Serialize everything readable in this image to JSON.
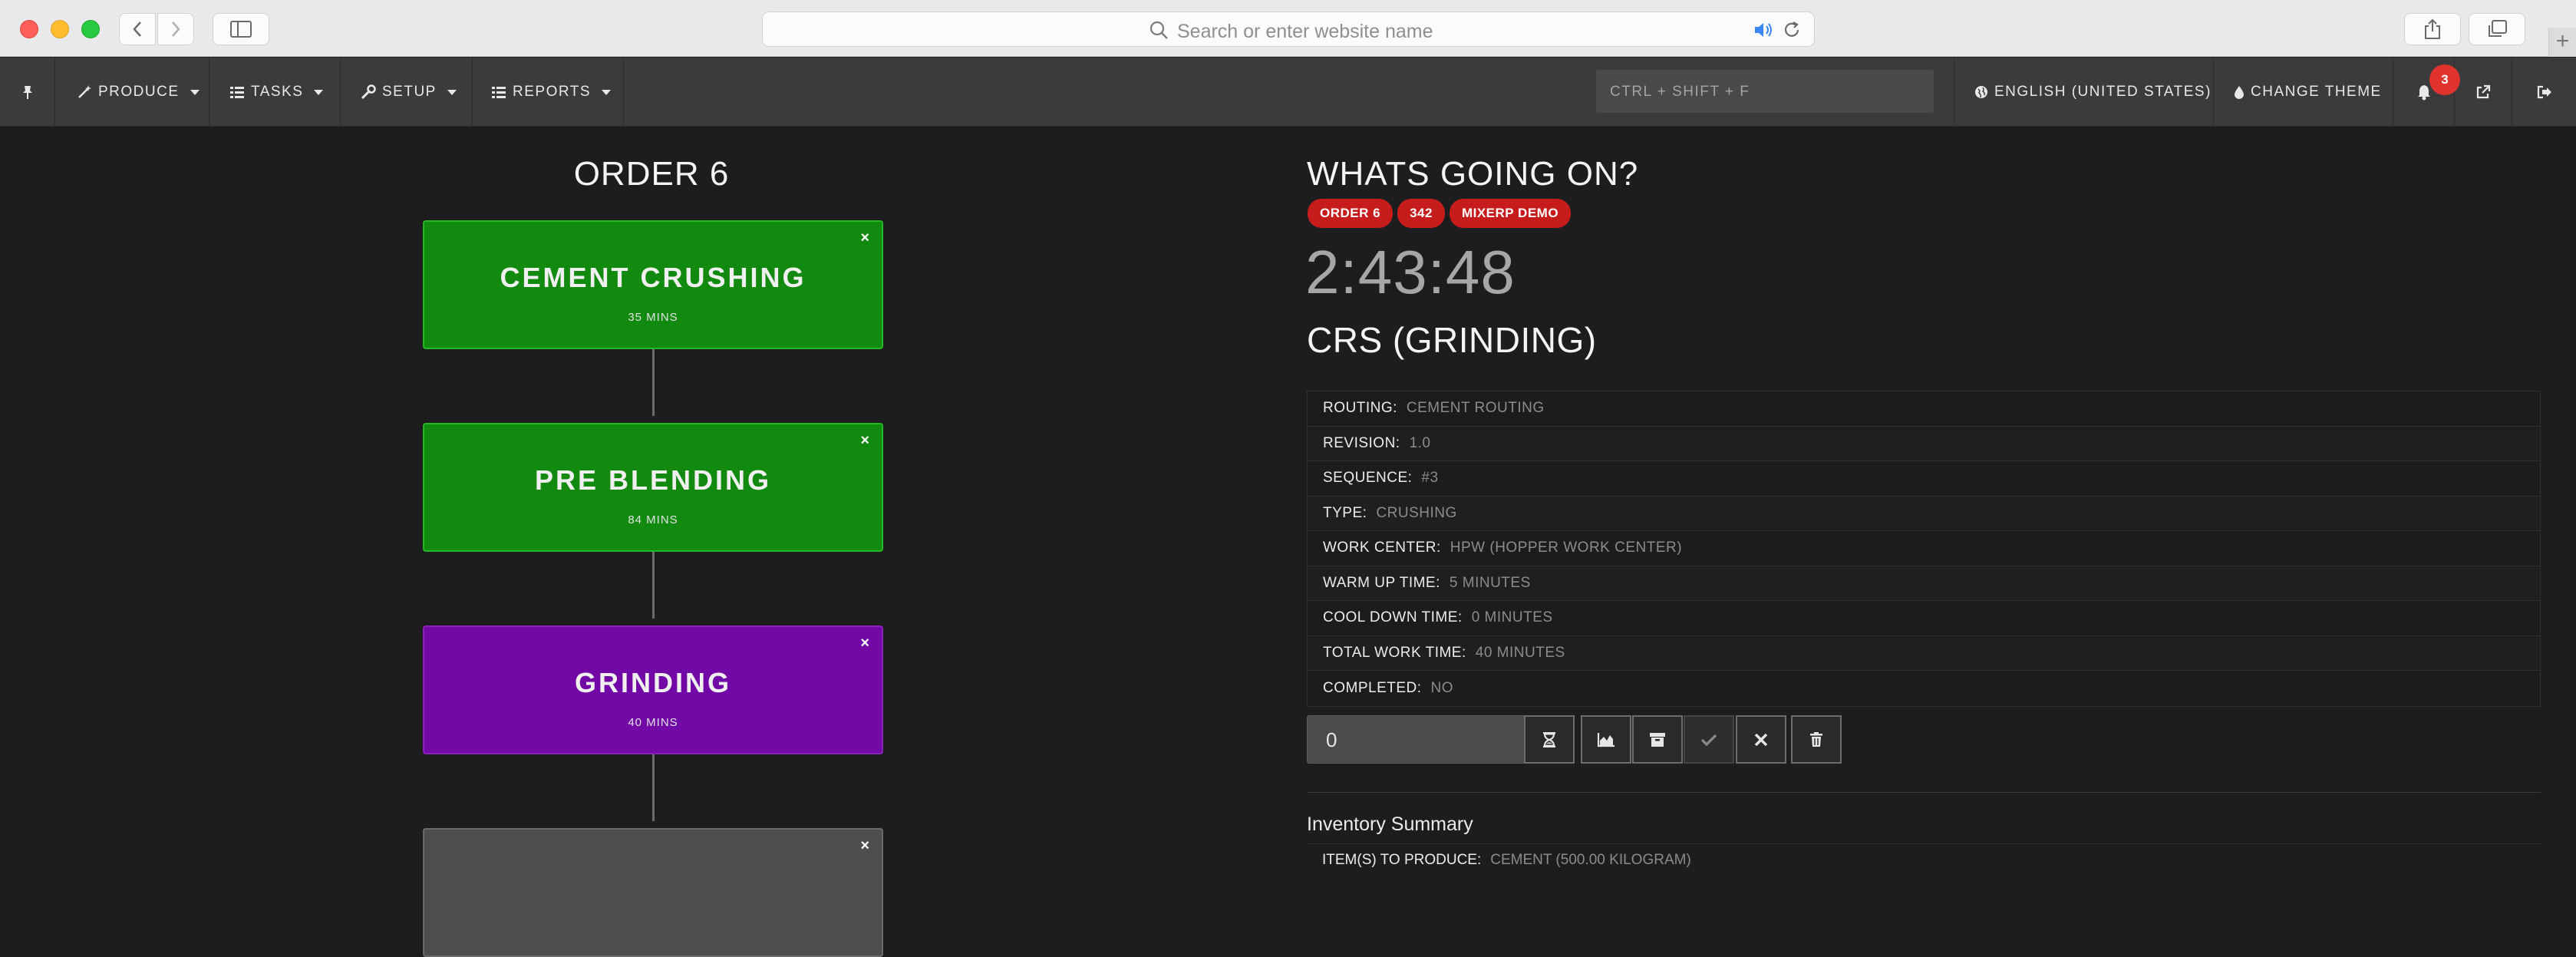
{
  "browser": {
    "address_placeholder": "Search or enter website name"
  },
  "nav": {
    "menus": [
      {
        "label": "PRODUCE",
        "icon": "magic-wand-icon"
      },
      {
        "label": "TASKS",
        "icon": "tasks-icon"
      },
      {
        "label": "SETUP",
        "icon": "wrench-icon"
      },
      {
        "label": "REPORTS",
        "icon": "list-icon"
      }
    ],
    "search_placeholder": "CTRL + SHIFT + F",
    "language": "ENGLISH (UNITED STATES)",
    "theme_label": "CHANGE THEME",
    "notification_count": "3"
  },
  "left": {
    "order_title": "ORDER 6",
    "cards": [
      {
        "title": "CEMENT CRUSHING",
        "duration": "35 MINS",
        "color": "#128a10",
        "close": "×"
      },
      {
        "title": "PRE BLENDING",
        "duration": "84 MINS",
        "color": "#128a10",
        "close": "×"
      },
      {
        "title": "GRINDING",
        "duration": "40 MINS",
        "color": "#7209a6",
        "close": "×"
      },
      {
        "title": "",
        "duration": "",
        "color": "#4e4e50",
        "close": "×"
      }
    ]
  },
  "right": {
    "heading": "WHATS GOING ON?",
    "tags": [
      "ORDER 6",
      "342",
      "MIXERP DEMO"
    ],
    "timer": "2:43:48",
    "operation": "CRS (GRINDING)",
    "details": [
      {
        "key": "ROUTING:",
        "value": "CEMENT ROUTING"
      },
      {
        "key": "REVISION:",
        "value": "1.0"
      },
      {
        "key": "SEQUENCE:",
        "value": "#3"
      },
      {
        "key": "TYPE:",
        "value": "CRUSHING"
      },
      {
        "key": "WORK CENTER:",
        "value": "HPW (HOPPER WORK CENTER)"
      },
      {
        "key": "WARM UP TIME:",
        "value": "5 MINUTES"
      },
      {
        "key": "COOL DOWN TIME:",
        "value": "0 MINUTES"
      },
      {
        "key": "TOTAL WORK TIME:",
        "value": "40 MINUTES"
      },
      {
        "key": "COMPLETED:",
        "value": "NO"
      }
    ],
    "quantity_value": "0",
    "inventory_title": "Inventory Summary",
    "inventory_row": {
      "key": "ITEM(S) TO PRODUCE:",
      "value": "CEMENT (500.00 KILOGRAM)"
    }
  },
  "colors": {
    "accent_red": "#c71c1c",
    "card_green": "#128a10",
    "card_purple": "#7209a6"
  }
}
